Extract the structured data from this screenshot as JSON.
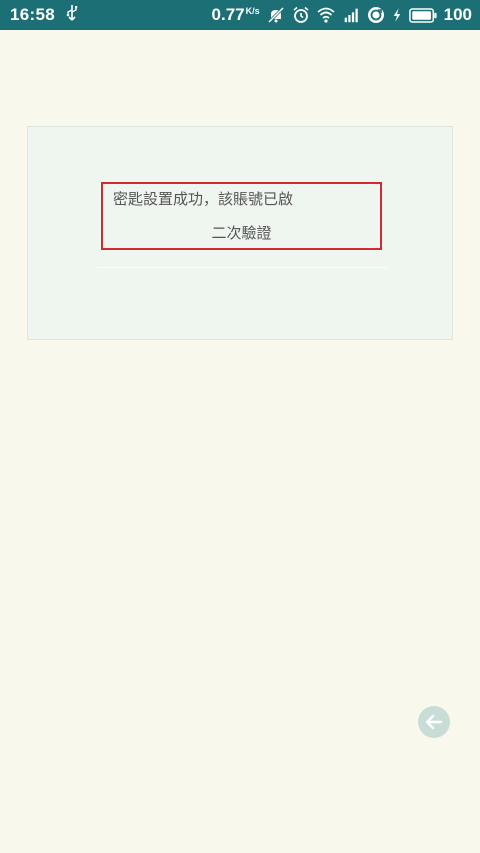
{
  "status_bar": {
    "time": "16:58",
    "net_speed": "0.77",
    "net_speed_unit": "K/s",
    "battery_level": "100",
    "icons": [
      "usb-icon",
      "mute-icon",
      "alarm-icon",
      "wifi-icon",
      "signal-icon",
      "sync-icon",
      "charging-icon",
      "battery-icon"
    ]
  },
  "dialog": {
    "message_line1": "密匙設置成功，該賬號已啟",
    "message_line2": "二次驗證"
  },
  "colors": {
    "status_bar_bg": "#1c6f74",
    "page_bg": "#f8f8ec",
    "highlight_border": "#d32a31",
    "back_button_bg": "#c9ddd7"
  }
}
